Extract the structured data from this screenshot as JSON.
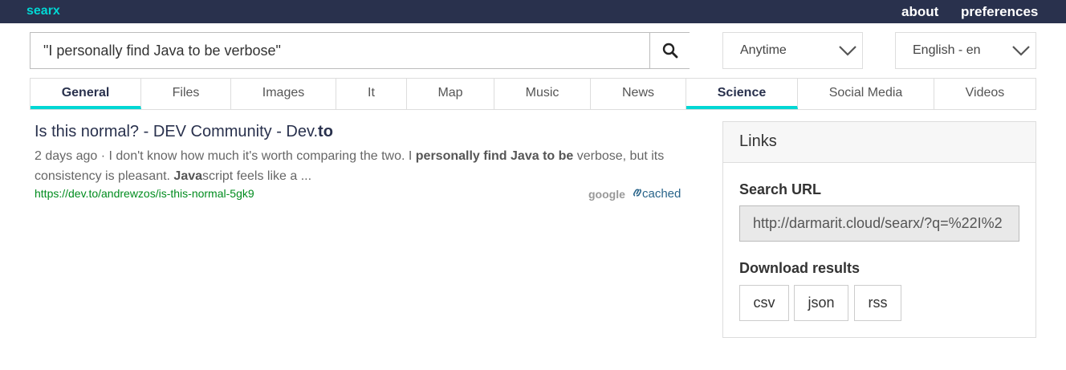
{
  "nav": {
    "brand": "searx",
    "about": "about",
    "preferences": "preferences"
  },
  "search": {
    "query": "\"I personally find Java to be verbose\"",
    "button_icon": "search-icon"
  },
  "filters": {
    "time_range": "Anytime",
    "language": "English - en"
  },
  "tabs": [
    {
      "label": "General",
      "active": true
    },
    {
      "label": "Files",
      "active": false
    },
    {
      "label": "Images",
      "active": false
    },
    {
      "label": "It",
      "active": false
    },
    {
      "label": "Map",
      "active": false
    },
    {
      "label": "Music",
      "active": false
    },
    {
      "label": "News",
      "active": false
    },
    {
      "label": "Science",
      "active": true
    },
    {
      "label": "Social Media",
      "active": false
    },
    {
      "label": "Videos",
      "active": false
    }
  ],
  "result": {
    "title_pre": "Is this normal? - DEV Community   - Dev.",
    "title_bold": "to",
    "age": "2 days ago",
    "sep": " · ",
    "content_1": "I don't know how much it's worth comparing the two. I ",
    "content_b1": "personally find Java to be",
    "content_2": " verbose, but its consistency is pleasant. ",
    "content_b2": "Java",
    "content_3": "script feels like a ...",
    "url": "https://dev.to/andrewzos/is-this-normal-5gk9",
    "engine": "google",
    "cached": "cached"
  },
  "sidebar": {
    "heading": "Links",
    "search_url_label": "Search URL",
    "search_url_value": "http://darmarit.cloud/searx/?q=%22I%2",
    "download_label": "Download results",
    "formats": {
      "csv": "csv",
      "json": "json",
      "rss": "rss"
    }
  },
  "colors": {
    "navbar": "#29314d",
    "accent": "#01d7d4",
    "url_green": "#008c1e",
    "link": "#29648a"
  }
}
